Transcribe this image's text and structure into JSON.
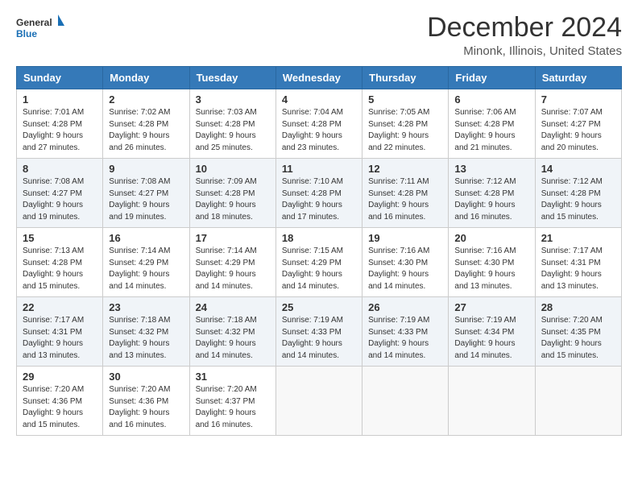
{
  "header": {
    "logo_general": "General",
    "logo_blue": "Blue",
    "month_title": "December 2024",
    "location": "Minonk, Illinois, United States"
  },
  "days_of_week": [
    "Sunday",
    "Monday",
    "Tuesday",
    "Wednesday",
    "Thursday",
    "Friday",
    "Saturday"
  ],
  "weeks": [
    [
      {
        "day": 1,
        "sunrise": "7:01 AM",
        "sunset": "4:28 PM",
        "daylight": "9 hours and 27 minutes."
      },
      {
        "day": 2,
        "sunrise": "7:02 AM",
        "sunset": "4:28 PM",
        "daylight": "9 hours and 26 minutes."
      },
      {
        "day": 3,
        "sunrise": "7:03 AM",
        "sunset": "4:28 PM",
        "daylight": "9 hours and 25 minutes."
      },
      {
        "day": 4,
        "sunrise": "7:04 AM",
        "sunset": "4:28 PM",
        "daylight": "9 hours and 23 minutes."
      },
      {
        "day": 5,
        "sunrise": "7:05 AM",
        "sunset": "4:28 PM",
        "daylight": "9 hours and 22 minutes."
      },
      {
        "day": 6,
        "sunrise": "7:06 AM",
        "sunset": "4:28 PM",
        "daylight": "9 hours and 21 minutes."
      },
      {
        "day": 7,
        "sunrise": "7:07 AM",
        "sunset": "4:27 PM",
        "daylight": "9 hours and 20 minutes."
      }
    ],
    [
      {
        "day": 8,
        "sunrise": "7:08 AM",
        "sunset": "4:27 PM",
        "daylight": "9 hours and 19 minutes."
      },
      {
        "day": 9,
        "sunrise": "7:08 AM",
        "sunset": "4:27 PM",
        "daylight": "9 hours and 19 minutes."
      },
      {
        "day": 10,
        "sunrise": "7:09 AM",
        "sunset": "4:28 PM",
        "daylight": "9 hours and 18 minutes."
      },
      {
        "day": 11,
        "sunrise": "7:10 AM",
        "sunset": "4:28 PM",
        "daylight": "9 hours and 17 minutes."
      },
      {
        "day": 12,
        "sunrise": "7:11 AM",
        "sunset": "4:28 PM",
        "daylight": "9 hours and 16 minutes."
      },
      {
        "day": 13,
        "sunrise": "7:12 AM",
        "sunset": "4:28 PM",
        "daylight": "9 hours and 16 minutes."
      },
      {
        "day": 14,
        "sunrise": "7:12 AM",
        "sunset": "4:28 PM",
        "daylight": "9 hours and 15 minutes."
      }
    ],
    [
      {
        "day": 15,
        "sunrise": "7:13 AM",
        "sunset": "4:28 PM",
        "daylight": "9 hours and 15 minutes."
      },
      {
        "day": 16,
        "sunrise": "7:14 AM",
        "sunset": "4:29 PM",
        "daylight": "9 hours and 14 minutes."
      },
      {
        "day": 17,
        "sunrise": "7:14 AM",
        "sunset": "4:29 PM",
        "daylight": "9 hours and 14 minutes."
      },
      {
        "day": 18,
        "sunrise": "7:15 AM",
        "sunset": "4:29 PM",
        "daylight": "9 hours and 14 minutes."
      },
      {
        "day": 19,
        "sunrise": "7:16 AM",
        "sunset": "4:30 PM",
        "daylight": "9 hours and 14 minutes."
      },
      {
        "day": 20,
        "sunrise": "7:16 AM",
        "sunset": "4:30 PM",
        "daylight": "9 hours and 13 minutes."
      },
      {
        "day": 21,
        "sunrise": "7:17 AM",
        "sunset": "4:31 PM",
        "daylight": "9 hours and 13 minutes."
      }
    ],
    [
      {
        "day": 22,
        "sunrise": "7:17 AM",
        "sunset": "4:31 PM",
        "daylight": "9 hours and 13 minutes."
      },
      {
        "day": 23,
        "sunrise": "7:18 AM",
        "sunset": "4:32 PM",
        "daylight": "9 hours and 13 minutes."
      },
      {
        "day": 24,
        "sunrise": "7:18 AM",
        "sunset": "4:32 PM",
        "daylight": "9 hours and 14 minutes."
      },
      {
        "day": 25,
        "sunrise": "7:19 AM",
        "sunset": "4:33 PM",
        "daylight": "9 hours and 14 minutes."
      },
      {
        "day": 26,
        "sunrise": "7:19 AM",
        "sunset": "4:33 PM",
        "daylight": "9 hours and 14 minutes."
      },
      {
        "day": 27,
        "sunrise": "7:19 AM",
        "sunset": "4:34 PM",
        "daylight": "9 hours and 14 minutes."
      },
      {
        "day": 28,
        "sunrise": "7:20 AM",
        "sunset": "4:35 PM",
        "daylight": "9 hours and 15 minutes."
      }
    ],
    [
      {
        "day": 29,
        "sunrise": "7:20 AM",
        "sunset": "4:36 PM",
        "daylight": "9 hours and 15 minutes."
      },
      {
        "day": 30,
        "sunrise": "7:20 AM",
        "sunset": "4:36 PM",
        "daylight": "9 hours and 16 minutes."
      },
      {
        "day": 31,
        "sunrise": "7:20 AM",
        "sunset": "4:37 PM",
        "daylight": "9 hours and 16 minutes."
      },
      null,
      null,
      null,
      null
    ]
  ]
}
